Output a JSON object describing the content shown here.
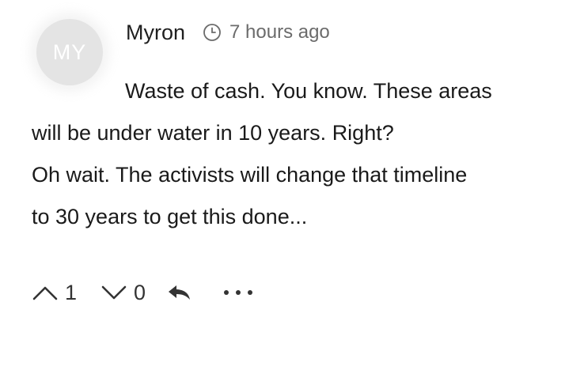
{
  "comment": {
    "avatar_initials": "MY",
    "author": "Myron",
    "timestamp": "7 hours ago",
    "body_lines": [
      "Waste of cash. You know. These areas",
      "will be under water in 10 years. Right?",
      "Oh wait. The activists will change that timeline",
      "to 30 years to get this done..."
    ]
  },
  "actions": {
    "upvote_icon": "chevron-up-icon",
    "upvote_count": "1",
    "downvote_icon": "chevron-down-icon",
    "downvote_count": "0",
    "reply_icon": "reply-arrow-icon",
    "more_icon": "more-horizontal-icon"
  },
  "colors": {
    "avatar_bg": "#e4e4e4",
    "text": "#1a1a1a",
    "muted": "#6b6b6b"
  }
}
